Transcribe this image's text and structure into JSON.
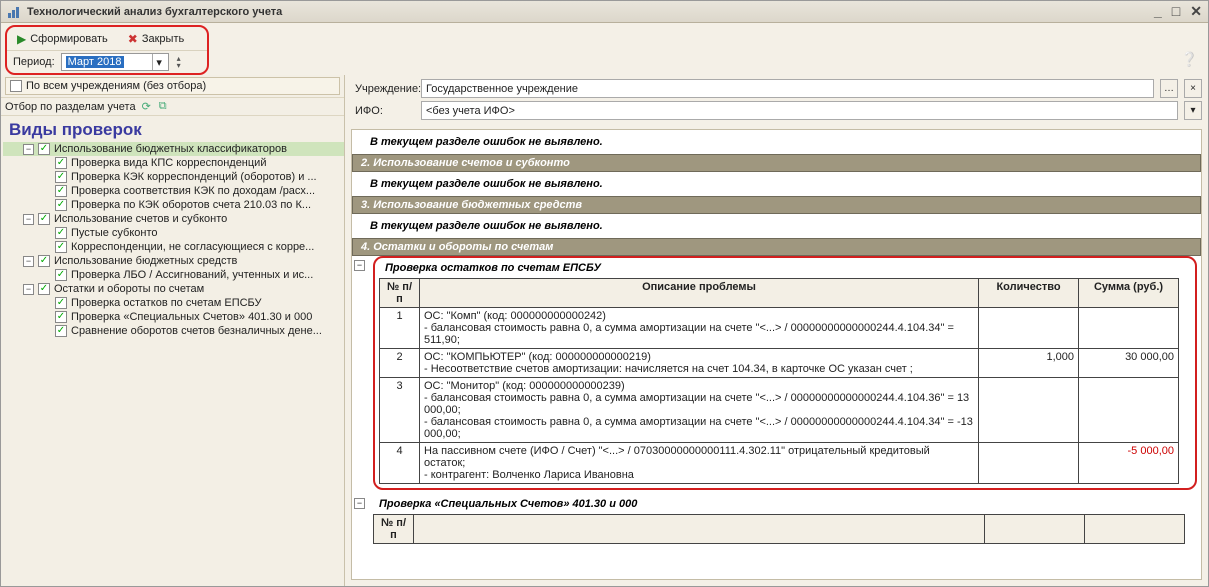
{
  "window": {
    "title": "Технологический анализ бухгалтерского учета"
  },
  "toolbar": {
    "form_btn": "Сформировать",
    "close_btn": "Закрыть"
  },
  "period": {
    "label": "Период:",
    "value": "Март 2018"
  },
  "all_orgs_cb": "По всем учреждениям (без отбора)",
  "filter_label": "Отбор по разделам учета",
  "checks_header": "Виды проверок",
  "tree": [
    {
      "type": "group",
      "label": "Использование бюджетных классификаторов",
      "sel": true
    },
    {
      "type": "leaf",
      "label": "Проверка вида КПС корреспонденций"
    },
    {
      "type": "leaf",
      "label": "Проверка КЭК корреспонденций (оборотов) и ..."
    },
    {
      "type": "leaf",
      "label": "Проверка соответствия КЭК по доходам /расх..."
    },
    {
      "type": "leaf",
      "label": "Проверка по КЭК оборотов счета 210.03 по К..."
    },
    {
      "type": "group",
      "label": "Использование счетов и субконто"
    },
    {
      "type": "leaf",
      "label": "Пустые субконто"
    },
    {
      "type": "leaf",
      "label": "Корреспонденции, не согласующиеся с корре..."
    },
    {
      "type": "group",
      "label": "Использование бюджетных средств"
    },
    {
      "type": "leaf",
      "label": "Проверка ЛБО / Ассигнований, учтенных и ис..."
    },
    {
      "type": "group",
      "label": "Остатки и обороты по счетам"
    },
    {
      "type": "leaf",
      "label": "Проверка остатков по счетам ЕПСБУ"
    },
    {
      "type": "leaf",
      "label": "Проверка «Специальных Счетов» 401.30 и 000"
    },
    {
      "type": "leaf",
      "label": "Сравнение оборотов счетов безналичных дене..."
    }
  ],
  "org": {
    "label": "Учреждение:",
    "value": "Государственное учреждение"
  },
  "ifo": {
    "label": "ИФО:",
    "value": "<без учета ИФО>"
  },
  "report": {
    "no_errors": "В текущем разделе ошибок не выявлено.",
    "band2": "2. Использование счетов и субконто",
    "band3": "3. Использование бюджетных средств",
    "band4": "4. Остатки и обороты по счетам",
    "check1_title": "Проверка остатков по счетам ЕПСБУ",
    "check2_title": "Проверка «Специальных Счетов» 401.30 и 000",
    "th_num": "№ п/п",
    "th_desc": "Описание проблемы",
    "th_qty": "Количество",
    "th_sum": "Сумма (руб.)",
    "rows": [
      {
        "n": "1",
        "desc": "ОС: \"Комп\" (код: 000000000000242)\n - балансовая стоимость равна 0, а сумма амортизации на счете \"<...> / 00000000000000244.4.104.34\" = 511,90;",
        "qty": "",
        "sum": ""
      },
      {
        "n": "2",
        "desc": "ОС: \"КОМПЬЮТЕР\" (код: 000000000000219)\n - Несоответствие счетов амортизации: начисляется на счет 104.34, в карточке ОС указан счет ;",
        "qty": "1,000",
        "sum": "30 000,00"
      },
      {
        "n": "3",
        "desc": "ОС: \"Монитор\" (код: 000000000000239)\n - балансовая стоимость равна 0, а сумма амортизации на счете \"<...> / 00000000000000244.4.104.36\" = 13 000,00;\n - балансовая стоимость равна 0, а сумма амортизации на счете \"<...> / 00000000000000244.4.104.34\" = -13 000,00;",
        "qty": "",
        "sum": ""
      },
      {
        "n": "4",
        "desc": "На пассивном счете (ИФО / Счет) \"<...> / 07030000000000111.4.302.11\" отрицательный кредитовый остаток;\n - контрагент: Волченко Лариса Ивановна",
        "qty": "",
        "sum": "-5 000,00",
        "neg": true
      }
    ]
  }
}
